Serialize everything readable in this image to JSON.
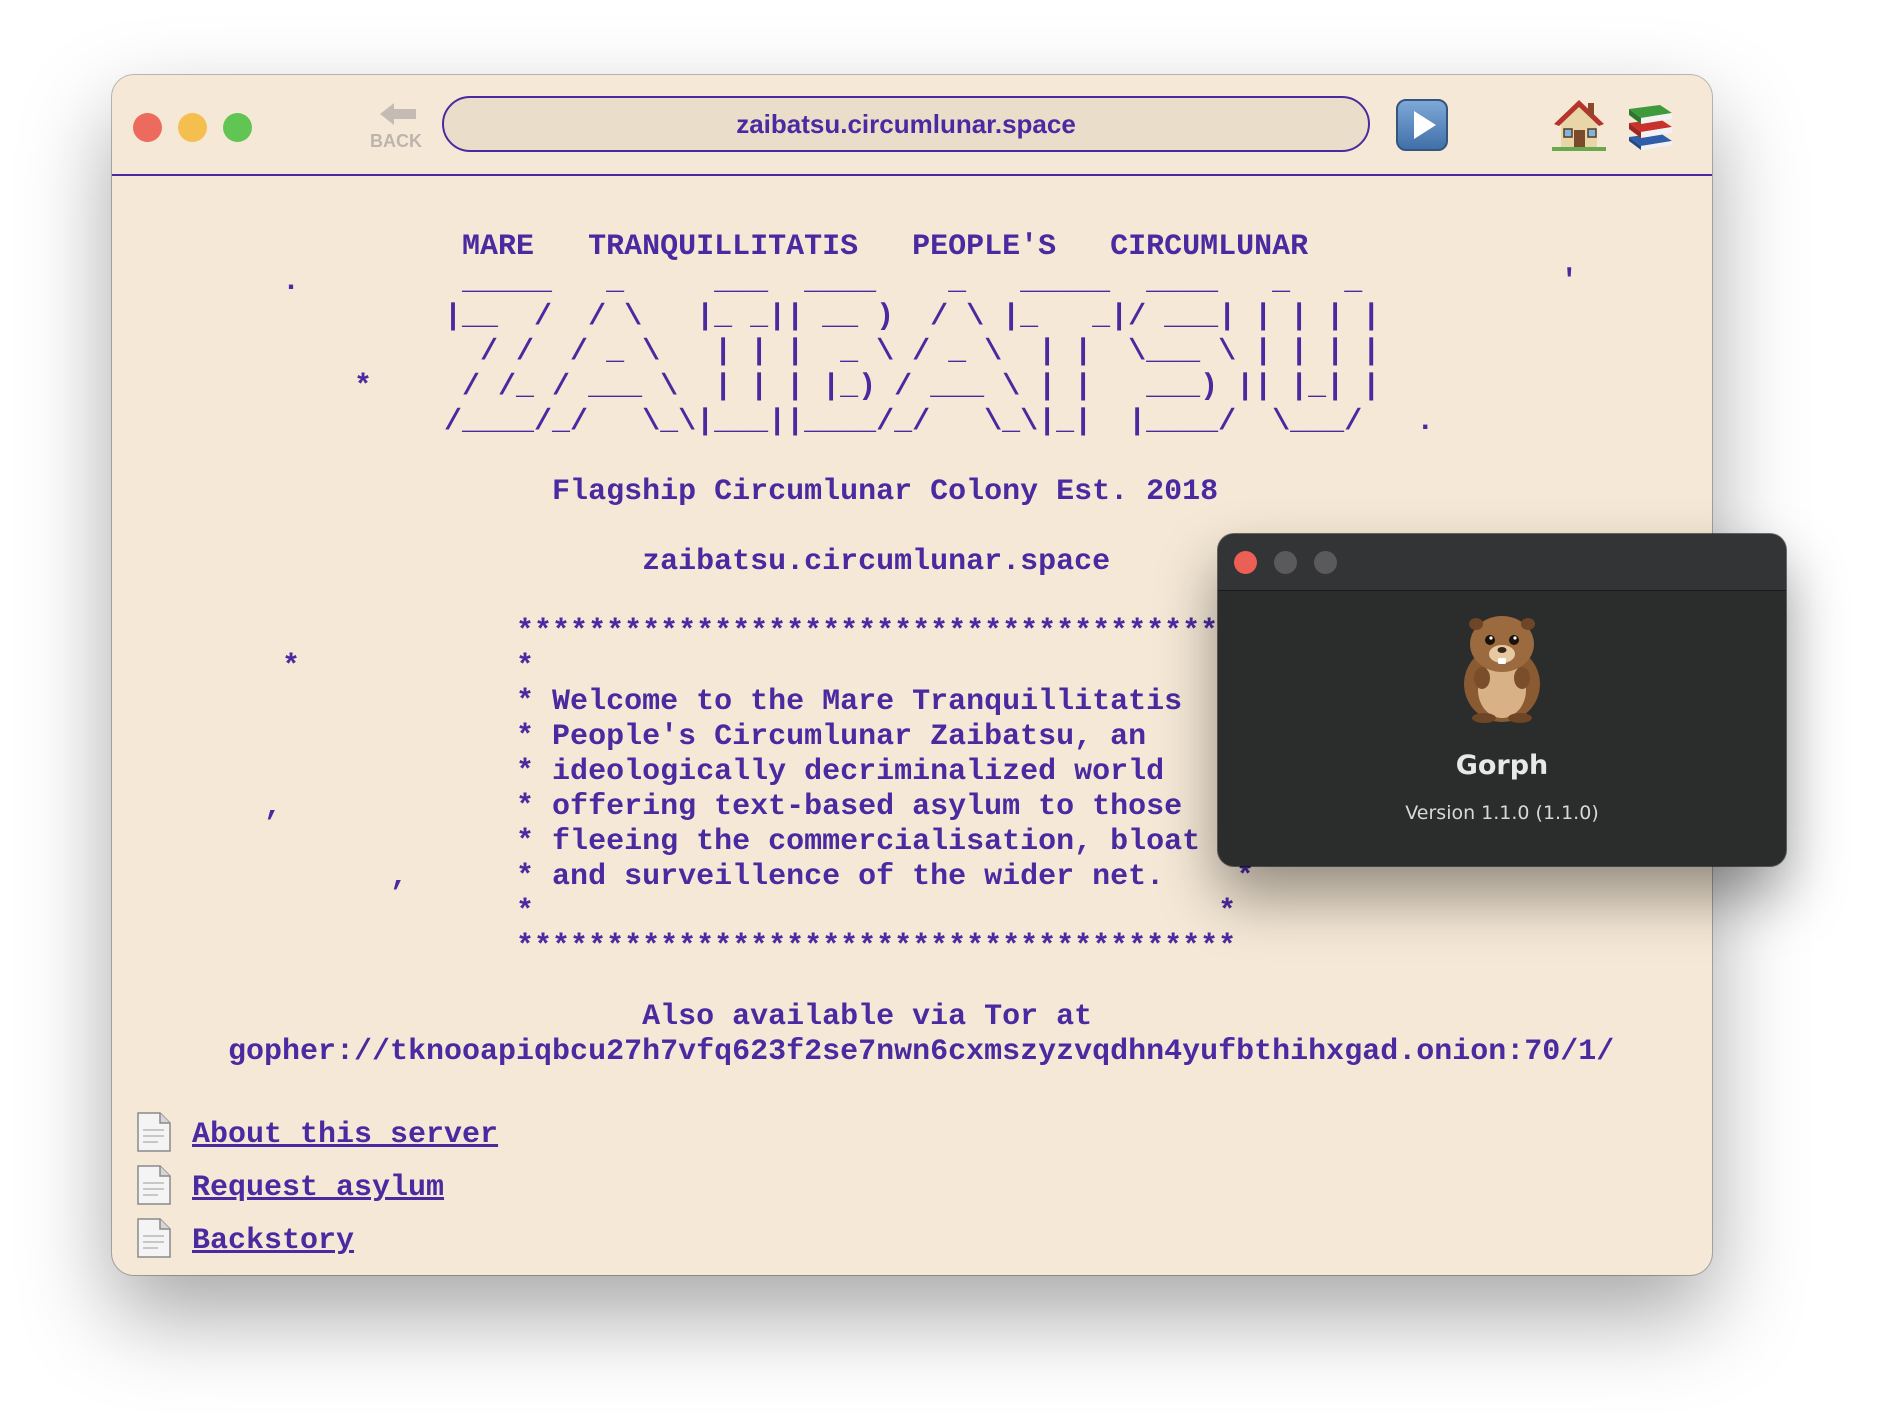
{
  "browser": {
    "back_label": "BACK",
    "url": "zaibatsu.circumlunar.space",
    "buttons": {
      "go": "play-arrow",
      "home": "house",
      "bookmarks": "books-stack"
    }
  },
  "gopher_page": {
    "lines": [
      "               MARE   TRANQUILLITATIS   PEOPLE'S   CIRCUMLUNAR",
      "     .         _____   _     ___  ____    _   _____  ____   _   _           '",
      "              |__  /  / \\   |_ _|| __ )  / \\ |_   _|/ ___| | | | |",
      "                / /  / _ \\   | | |  _ \\ / _ \\  | |  \\___ \\ | | | |",
      "         *     / /_ / ___ \\  | | | |_) / ___ \\ | |   ___) || |_| |",
      "              /____/_/   \\_\\|___||____/_/   \\_\\|_|  |____/  \\___/   .",
      "",
      "                    Flagship Circumlunar Colony Est. 2018",
      "",
      "                         zaibatsu.circumlunar.space",
      "",
      "                  ****************************************",
      "     *            *                                      *",
      "                  * Welcome to the Mare Tranquillitatis   *",
      "                  * People's Circumlunar Zaibatsu, an     *",
      "                  * ideologically decriminalized world    *",
      "    ,             * offering text-based asylum to those   *",
      "                  * fleeing the commercialisation, bloat  *",
      "           ,      * and surveillence of the wider net.    *",
      "                  *                                      *",
      "                  ****************************************",
      "",
      "                         Also available via Tor at",
      "  gopher://tknooapiqbcu27h7vfq623f2se7nwn6cxmszyzvqdhn4yufbthihxgad.onion:70/1/"
    ],
    "links": [
      {
        "label": "About this server",
        "icon": "document-icon"
      },
      {
        "label": "Request asylum",
        "icon": "document-icon"
      },
      {
        "label": "Backstory",
        "icon": "document-icon"
      }
    ]
  },
  "about_dialog": {
    "app_icon": "gopher-icon",
    "app_name": "Gorph",
    "version": "Version 1.1.0 (1.1.0)"
  },
  "colors": {
    "accent": "#4a2aa0",
    "page_background": "#f5e8d6",
    "dialog_background": "#2b2c2c"
  }
}
